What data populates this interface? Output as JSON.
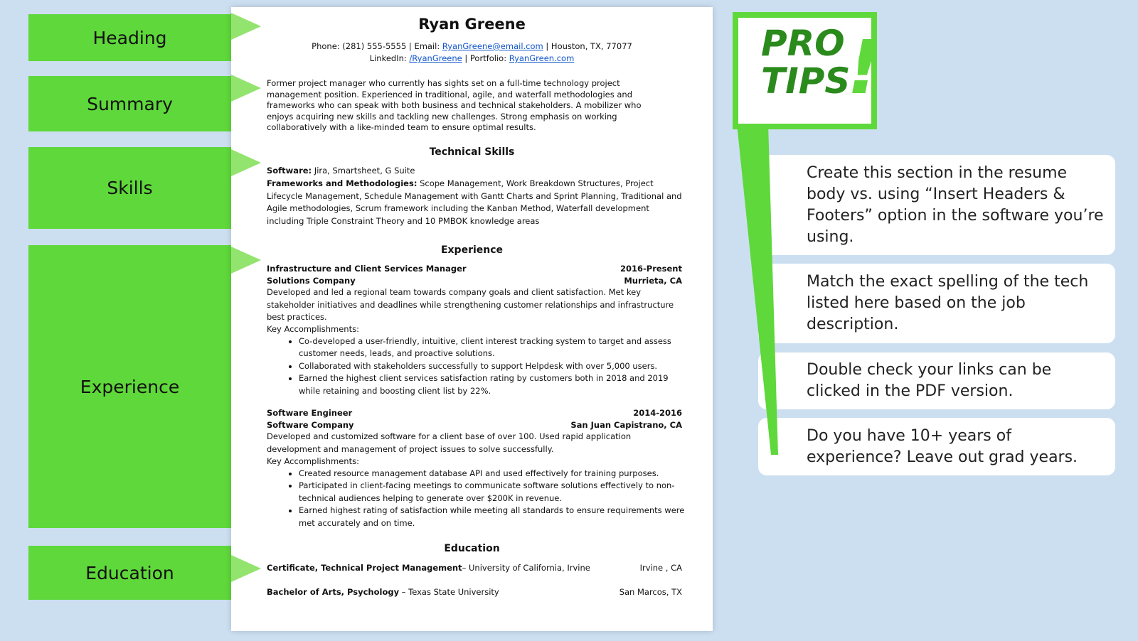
{
  "sections": [
    "Heading",
    "Summary",
    "Skills",
    "Experience",
    "Education"
  ],
  "resume": {
    "name": "Ryan Greene",
    "contact1_a": "Phone: (281) 555-5555 | Email: ",
    "email": "RyanGreene@email.com",
    "contact1_b": " | Houston, TX, 77077",
    "contact2_a": "LinkedIn: ",
    "linkedin": "/RyanGreene",
    "contact2_b": " | Portfolio: ",
    "portfolio": "RyanGreen.com",
    "summary": "Former project manager who currently has sights set on a full-time technology project management position. Experienced in traditional, agile, and waterfall methodologies and frameworks who can speak with both business and technical stakeholders. A mobilizer who enjoys acquiring new skills and tackling new challenges. Strong emphasis on working collaboratively with a like-minded team to ensure optimal results.",
    "skills_title": "Technical Skills",
    "software_label": "Software:",
    "software_value": " Jira, Smartsheet, G Suite",
    "frameworks_label": "Frameworks and Methodologies:",
    "frameworks_value": " Scope Management, Work Breakdown Structures, Project Lifecycle Management, Schedule Management with Gantt Charts and Sprint Planning, Traditional and Agile methodologies, Scrum framework including the Kanban Method, Waterfall development including Triple Constraint Theory and 10 PMBOK knowledge areas",
    "experience_title": "Experience",
    "jobs": [
      {
        "title": "Infrastructure and Client Services Manager",
        "dates": "2016-Present",
        "company": "Solutions Company",
        "location": "Murrieta, CA",
        "description": "Developed and led a regional team towards company goals and client satisfaction. Met key stakeholder initiatives and deadlines while strengthening customer relationships and infrastructure best practices.",
        "accomplishments_label": "Key Accomplishments:",
        "bullets": [
          "Co-developed a user-friendly, intuitive, client interest tracking system to target and assess customer needs, leads, and proactive solutions.",
          "Collaborated with stakeholders successfully to support Helpdesk with over 5,000 users.",
          "Earned the highest client services satisfaction rating by customers both in 2018 and 2019 while retaining and boosting client list by 22%."
        ]
      },
      {
        "title": "Software Engineer",
        "dates": "2014-2016",
        "company": "Software Company",
        "location": "San Juan Capistrano, CA",
        "description": "Developed and customized software for a client base of over 100. Used rapid application development and management of project issues to solve successfully.",
        "accomplishments_label": "Key Accomplishments:",
        "bullets": [
          "Created resource management database API and used effectively for training purposes.",
          "Participated in client-facing meetings to communicate software solutions effectively to non-technical audiences helping to generate over $200K in revenue.",
          "Earned highest rating of satisfaction while meeting all standards to ensure requirements were met accurately and on time."
        ]
      }
    ],
    "education_title": "Education",
    "education": [
      {
        "degree": "Certificate, Technical Project Management",
        "school": "– University of California, Irvine",
        "location": "Irvine , CA"
      },
      {
        "degree": "Bachelor of Arts, Psychology",
        "school": " – Texas State University",
        "location": "San Marcos, TX"
      }
    ]
  },
  "pro_tips": {
    "title_line1": "Pro",
    "title_line2": "Tips",
    "exclaim": "!",
    "tips": [
      "Create this section in the resume body vs. using “Insert Headers & Footers” option in the software you’re using.",
      "Match the exact spelling of the tech listed here based on the job description.",
      "Double check your links can be clicked in the PDF version.",
      "Do you have 10+ years of experience? Leave out grad years."
    ]
  },
  "colors": {
    "band": "#5ed83a",
    "pointer": "#93e46e",
    "background": "#ccdff1",
    "link": "#1155cc",
    "pro_text": "#2a8a1c"
  }
}
